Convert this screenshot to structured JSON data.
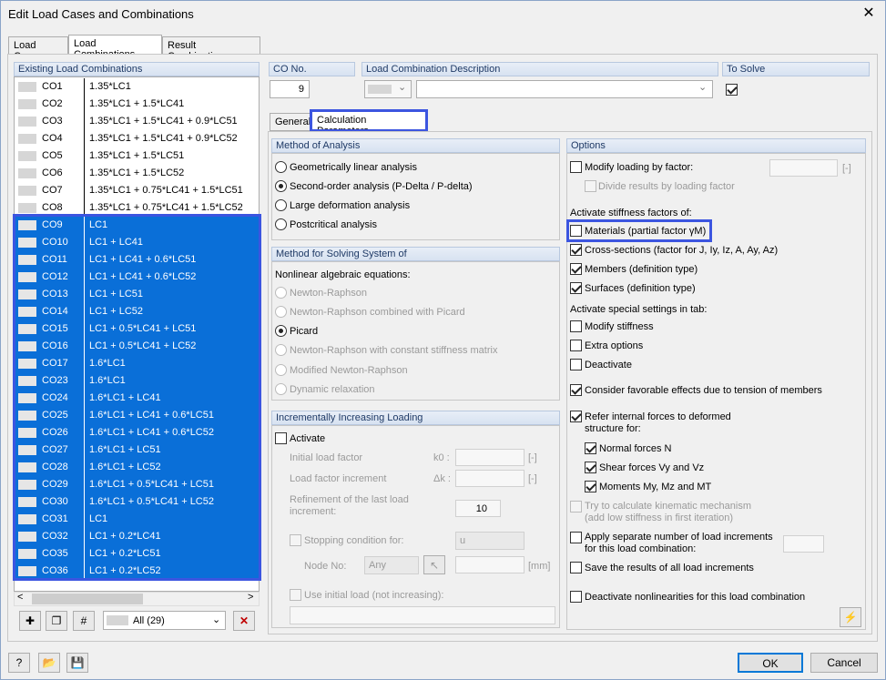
{
  "window": {
    "title": "Edit Load Cases and Combinations",
    "close": "✕"
  },
  "main_tabs": [
    "Load Cases",
    "Load Combinations",
    "Result Combinations"
  ],
  "list": {
    "header": "Existing Load Combinations",
    "rows": [
      {
        "no": "CO1",
        "desc": "1.35*LC1"
      },
      {
        "no": "CO2",
        "desc": "1.35*LC1 + 1.5*LC41"
      },
      {
        "no": "CO3",
        "desc": "1.35*LC1 + 1.5*LC41 + 0.9*LC51"
      },
      {
        "no": "CO4",
        "desc": "1.35*LC1 + 1.5*LC41 + 0.9*LC52"
      },
      {
        "no": "CO5",
        "desc": "1.35*LC1 + 1.5*LC51"
      },
      {
        "no": "CO6",
        "desc": "1.35*LC1 + 1.5*LC52"
      },
      {
        "no": "CO7",
        "desc": "1.35*LC1 + 0.75*LC41 + 1.5*LC51"
      },
      {
        "no": "CO8",
        "desc": "1.35*LC1 + 0.75*LC41 + 1.5*LC52"
      },
      {
        "no": "CO9",
        "desc": "LC1"
      },
      {
        "no": "CO10",
        "desc": "LC1 + LC41"
      },
      {
        "no": "CO11",
        "desc": "LC1 + LC41 + 0.6*LC51"
      },
      {
        "no": "CO12",
        "desc": "LC1 + LC41 + 0.6*LC52"
      },
      {
        "no": "CO13",
        "desc": "LC1 + LC51"
      },
      {
        "no": "CO14",
        "desc": "LC1 + LC52"
      },
      {
        "no": "CO15",
        "desc": "LC1 + 0.5*LC41 + LC51"
      },
      {
        "no": "CO16",
        "desc": "LC1 + 0.5*LC41 + LC52"
      },
      {
        "no": "CO17",
        "desc": "1.6*LC1"
      },
      {
        "no": "CO23",
        "desc": "1.6*LC1"
      },
      {
        "no": "CO24",
        "desc": "1.6*LC1 + LC41"
      },
      {
        "no": "CO25",
        "desc": "1.6*LC1 + LC41 + 0.6*LC51"
      },
      {
        "no": "CO26",
        "desc": "1.6*LC1 + LC41 + 0.6*LC52"
      },
      {
        "no": "CO27",
        "desc": "1.6*LC1 + LC51"
      },
      {
        "no": "CO28",
        "desc": "1.6*LC1 + LC52"
      },
      {
        "no": "CO29",
        "desc": "1.6*LC1 + 0.5*LC41 + LC51"
      },
      {
        "no": "CO30",
        "desc": "1.6*LC1 + 0.5*LC41 + LC52"
      },
      {
        "no": "CO31",
        "desc": "LC1"
      },
      {
        "no": "CO32",
        "desc": "LC1 + 0.2*LC41"
      },
      {
        "no": "CO35",
        "desc": "LC1 + 0.2*LC51"
      },
      {
        "no": "CO36",
        "desc": "LC1 + 0.2*LC52"
      }
    ],
    "filter": "All (29)"
  },
  "co_no": {
    "label": "CO No.",
    "value": "9"
  },
  "description": {
    "label": "Load Combination Description",
    "value": ""
  },
  "to_solve": {
    "label": "To Solve"
  },
  "sub_tabs": [
    "General",
    "Calculation Parameters"
  ],
  "method_analysis": {
    "header": "Method of Analysis",
    "options": [
      "Geometrically linear analysis",
      "Second-order analysis (P-Delta / P-delta)",
      "Large deformation analysis",
      "Postcritical analysis"
    ]
  },
  "method_solving": {
    "header": "Method for Solving System of",
    "sub": "Nonlinear algebraic equations:",
    "options": [
      "Newton-Raphson",
      "Newton-Raphson combined with Picard",
      "Picard",
      "Newton-Raphson with constant stiffness matrix",
      "Modified Newton-Raphson",
      "Dynamic relaxation"
    ]
  },
  "incremental": {
    "header": "Incrementally Increasing Loading",
    "activate": "Activate",
    "initial_factor": "Initial load factor",
    "initial_sym": "k0 :",
    "factor_inc": "Load factor increment",
    "factor_sym": "Δk :",
    "refine_1": "Refinement of the last load",
    "refine_2": "increment:",
    "refine_value": "10",
    "stopping": "Stopping condition for:",
    "stopping_value": "u",
    "node_no": "Node No:",
    "node_value": "Any",
    "unit_blank": "[-]",
    "unit_mm": "[mm]",
    "use_initial": "Use initial load (not increasing):"
  },
  "options": {
    "header": "Options",
    "modify_loading": "Modify loading by factor:",
    "divide_results": "Divide results by loading factor",
    "activate_stiffness": "Activate stiffness factors of:",
    "materials": "Materials (partial factor γM)",
    "cross_sections": "Cross-sections (factor for J, Iy, Iz, A, Ay, Az)",
    "members": "Members (definition type)",
    "surfaces": "Surfaces (definition type)",
    "activate_special": "Activate special settings in tab:",
    "modify_stiffness": "Modify stiffness",
    "extra_options": "Extra options",
    "deactivate": "Deactivate",
    "favorable": "Consider favorable effects due to tension of members",
    "refer_1": "Refer internal forces to deformed",
    "refer_2": "structure for:",
    "normal": "Normal forces N",
    "shear": "Shear forces Vy and Vz",
    "moments": "Moments My, Mz and MT",
    "kinematic_1": "Try to calculate kinematic mechanism",
    "kinematic_2": "(add low stiffness in first iteration)",
    "separate_1": "Apply separate number of load increments",
    "separate_2": "for this load combination:",
    "save_results": "Save the results of all load increments",
    "deactivate_nonlin": "Deactivate nonlinearities for this load combination",
    "unit": "[-]"
  },
  "footer": {
    "ok": "OK",
    "cancel": "Cancel"
  }
}
